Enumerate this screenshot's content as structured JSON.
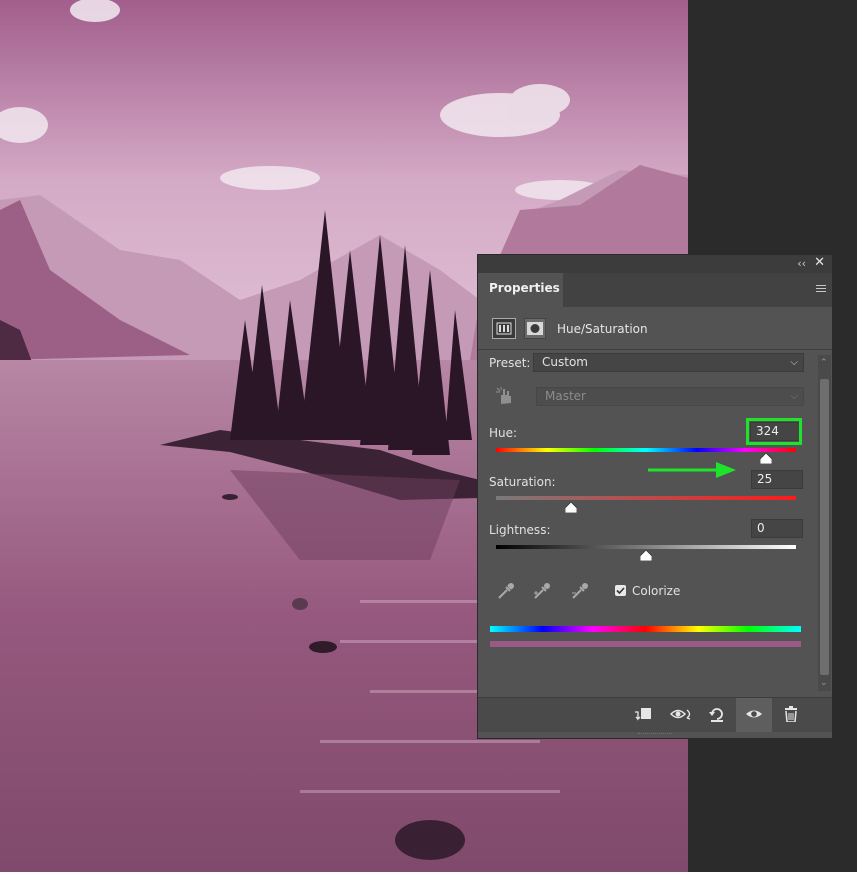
{
  "panel": {
    "tab_title": "Properties",
    "adjustment_title": "Hue/Saturation",
    "preset_label": "Preset:",
    "preset_value": "Custom",
    "channel_value": "Master",
    "hue_label": "Hue:",
    "hue_value": "324",
    "saturation_label": "Saturation:",
    "saturation_value": "25",
    "lightness_label": "Lightness:",
    "lightness_value": "0",
    "colorize_label": "Colorize",
    "colorize_checked": true,
    "hue_slider_fraction": 0.9,
    "saturation_slider_fraction": 0.25,
    "lightness_slider_fraction": 0.5
  },
  "icons": {
    "collapse": "double-chevron-left-icon",
    "close": "close-icon",
    "menu": "panel-menu-icon",
    "adjustment": "hue-saturation-icon",
    "mask": "mask-icon",
    "targeted": "targeted-adjustment-hand-icon",
    "eyedroppers": [
      "eyedropper-icon",
      "eyedropper-plus-icon",
      "eyedropper-minus-icon"
    ],
    "bottom": [
      "clip-to-layer-icon",
      "view-previous-state-icon",
      "reset-icon",
      "visibility-eye-icon",
      "trash-icon"
    ]
  },
  "colors": {
    "panel_bg": "#535353",
    "highlight": "#1ee32a",
    "arrow": "#1ee32a",
    "tint": "#9a5a86"
  }
}
